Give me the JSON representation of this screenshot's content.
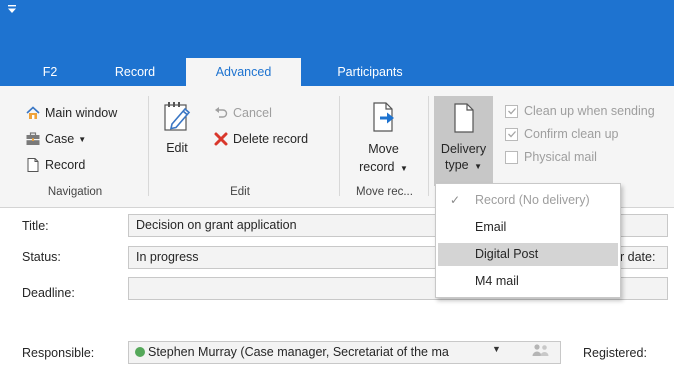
{
  "ribbon_tabs": [
    {
      "label": "F2"
    },
    {
      "label": "Record"
    },
    {
      "label": "Advanced"
    },
    {
      "label": "Participants"
    }
  ],
  "navigation_group": {
    "main_window": "Main window",
    "case": "Case",
    "record": "Record",
    "label": "Navigation"
  },
  "edit_group": {
    "edit": "Edit",
    "cancel": "Cancel",
    "delete_record": "Delete record",
    "label": "Edit"
  },
  "move_group": {
    "move_line1": "Move",
    "move_line2": "record",
    "label": "Move rec..."
  },
  "delivery_group": {
    "line1": "Delivery",
    "line2": "type"
  },
  "options": {
    "clean_up_when_sending": "Clean up when sending",
    "confirm_clean_up": "Confirm clean up",
    "physical_mail": "Physical mail"
  },
  "delivery_menu": {
    "items": [
      {
        "label": "Record (No delivery)",
        "checked": true
      },
      {
        "label": "Email",
        "checked": false
      },
      {
        "label": "Digital Post",
        "checked": false
      },
      {
        "label": "M4 mail",
        "checked": false
      }
    ]
  },
  "form": {
    "title_label": "Title:",
    "title_value": "Decision on grant application",
    "status_label": "Status:",
    "status_value": "In progress",
    "deadline_label": "Deadline:",
    "deadline_value": "",
    "responsible_label": "Responsible:",
    "responsible_value": "Stephen Murray (Case manager, Secretariat of the ma",
    "right_date_fragment": "r date:",
    "registered_label": "Registered:"
  },
  "colors": {
    "title_bar": "#1e73d0",
    "ribbon": "#f5f5f5",
    "delete_red": "#d9372b",
    "move_arrow": "#1e73d0",
    "status_dot": "#55a85a"
  }
}
